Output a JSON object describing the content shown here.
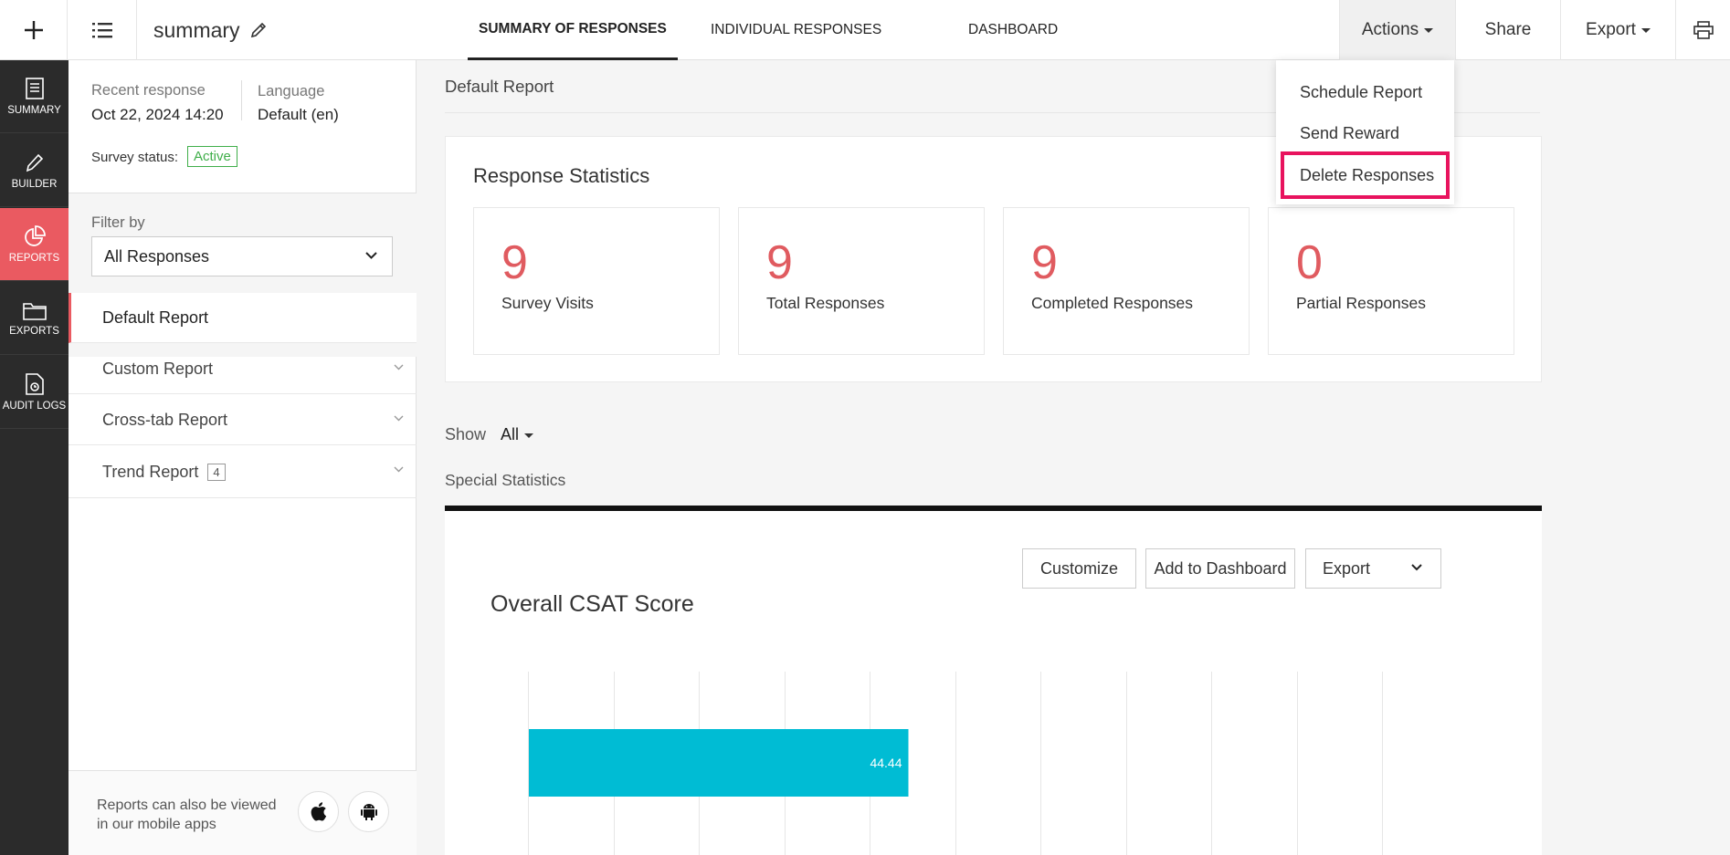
{
  "topbar": {
    "title": "summary",
    "tabs": [
      {
        "label": "SUMMARY OF RESPONSES"
      },
      {
        "label": "INDIVIDUAL RESPONSES"
      },
      {
        "label": "DASHBOARD"
      }
    ],
    "actions_label": "Actions",
    "share_label": "Share",
    "export_label": "Export"
  },
  "leftnav": {
    "items": [
      {
        "label": "SUMMARY",
        "icon": "document-icon"
      },
      {
        "label": "BUILDER",
        "icon": "pencil-icon"
      },
      {
        "label": "REPORTS",
        "icon": "pie-chart-icon"
      },
      {
        "label": "EXPORTS",
        "icon": "folder-icon"
      },
      {
        "label": "AUDIT LOGS",
        "icon": "audit-log-icon"
      }
    ]
  },
  "sidepanel": {
    "recent_label": "Recent response",
    "recent_value": "Oct 22, 2024 14:20",
    "language_label": "Language",
    "language_value": "Default (en)",
    "status_label": "Survey status:",
    "status_value": "Active",
    "filter_label": "Filter by",
    "filter_value": "All Responses",
    "reports": [
      {
        "label": "Default Report"
      },
      {
        "label": "Custom Report"
      },
      {
        "label": "Cross-tab Report"
      },
      {
        "label": "Trend Report",
        "count": "4"
      }
    ],
    "footer_text": "Reports can also be viewed in our mobile apps"
  },
  "main": {
    "title": "Default Report",
    "stats_title": "Response Statistics",
    "stats": [
      {
        "value": "9",
        "label": "Survey Visits"
      },
      {
        "value": "9",
        "label": "Total Responses"
      },
      {
        "value": "9",
        "label": "Completed Responses"
      },
      {
        "value": "0",
        "label": "Partial Responses"
      }
    ],
    "show_label": "Show",
    "show_value": "All",
    "special_label": "Special Statistics",
    "csat": {
      "title": "Overall CSAT Score",
      "customize_label": "Customize",
      "add_dashboard_label": "Add to Dashboard",
      "export_label": "Export"
    }
  },
  "dropdown": {
    "items": [
      {
        "label": "Schedule Report"
      },
      {
        "label": "Send Reward"
      },
      {
        "label": "Delete Responses"
      }
    ]
  },
  "chart_data": {
    "type": "bar",
    "orientation": "horizontal",
    "categories": [
      ""
    ],
    "values": [
      44.44
    ],
    "data_labels": [
      "44.44"
    ],
    "xlim": [
      0,
      100
    ],
    "grid": true,
    "color": "#00bcd4"
  },
  "colors": {
    "accent": "#ea5a61",
    "stat_number": "#e05b60",
    "active_badge": "#3fae49",
    "highlight_border": "#e8135e",
    "bar": "#00bcd4"
  }
}
